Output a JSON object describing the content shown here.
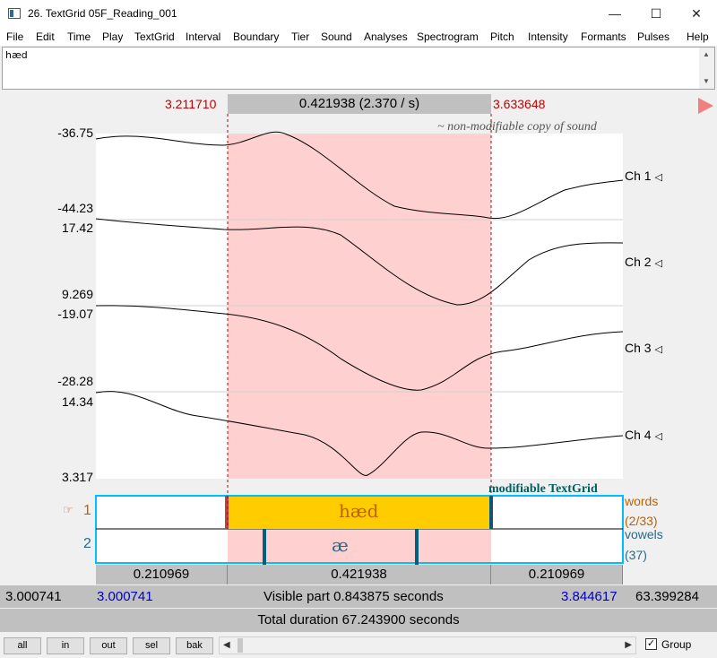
{
  "window": {
    "title": "26. TextGrid 05F_Reading_001",
    "minimize_glyph": "—",
    "maximize_glyph": "☐",
    "close_glyph": "✕"
  },
  "menu": [
    "File",
    "Edit",
    "Time",
    "Play",
    "TextGrid",
    "Interval",
    "Boundary",
    "Tier",
    "Sound",
    "Analyses",
    "Spectrogram",
    "Pitch",
    "Intensity",
    "Formants",
    "Pulses",
    "Help"
  ],
  "text_field": {
    "value": "hæd"
  },
  "selection": {
    "start": "3.211710",
    "end": "3.633648",
    "duration_label": "0.421938 (2.370 / s)"
  },
  "sound": {
    "note": "~ non-modifiable copy of sound",
    "channels": [
      {
        "label": "Ch 1",
        "ymax": "-36.75",
        "ymin": "-44.23"
      },
      {
        "label": "Ch 2",
        "ymax": "17.42",
        "ymin": "9.269"
      },
      {
        "label": "Ch 3",
        "ymax": "-19.07",
        "ymin": "-28.28"
      },
      {
        "label": "Ch 4",
        "ymax": "14.34",
        "ymin": "3.317"
      }
    ],
    "speaker_glyph": "◁"
  },
  "textgrid": {
    "note": "modifiable TextGrid",
    "tiers": [
      {
        "number": "1",
        "pointer": "☞",
        "name": "words",
        "count": "(2/33)",
        "interval_text": "hæd"
      },
      {
        "number": "2",
        "name": "vowels",
        "count": "(37)",
        "interval_text": "æ"
      }
    ]
  },
  "durations": {
    "left": "0.210969",
    "selected": "0.421938",
    "right": "0.210969"
  },
  "window_range": {
    "total_start": "3.000741",
    "visible_start": "3.000741",
    "visible_label": "Visible part 0.843875 seconds",
    "visible_end": "3.844617",
    "total_end": "63.399284"
  },
  "total_duration": "Total duration 67.243900 seconds",
  "controls": {
    "buttons": [
      "all",
      "in",
      "out",
      "sel",
      "bak"
    ],
    "group_label": "Group",
    "group_checked": true
  },
  "colors": {
    "selection_fill": "#ffd0d0",
    "selection_line": "#c00000",
    "interval_fill": "#ffcc00",
    "tier_border": "#00bfff",
    "boundary": "#006080",
    "word_text": "#c06000",
    "vowel_text": "#2a6a88"
  }
}
